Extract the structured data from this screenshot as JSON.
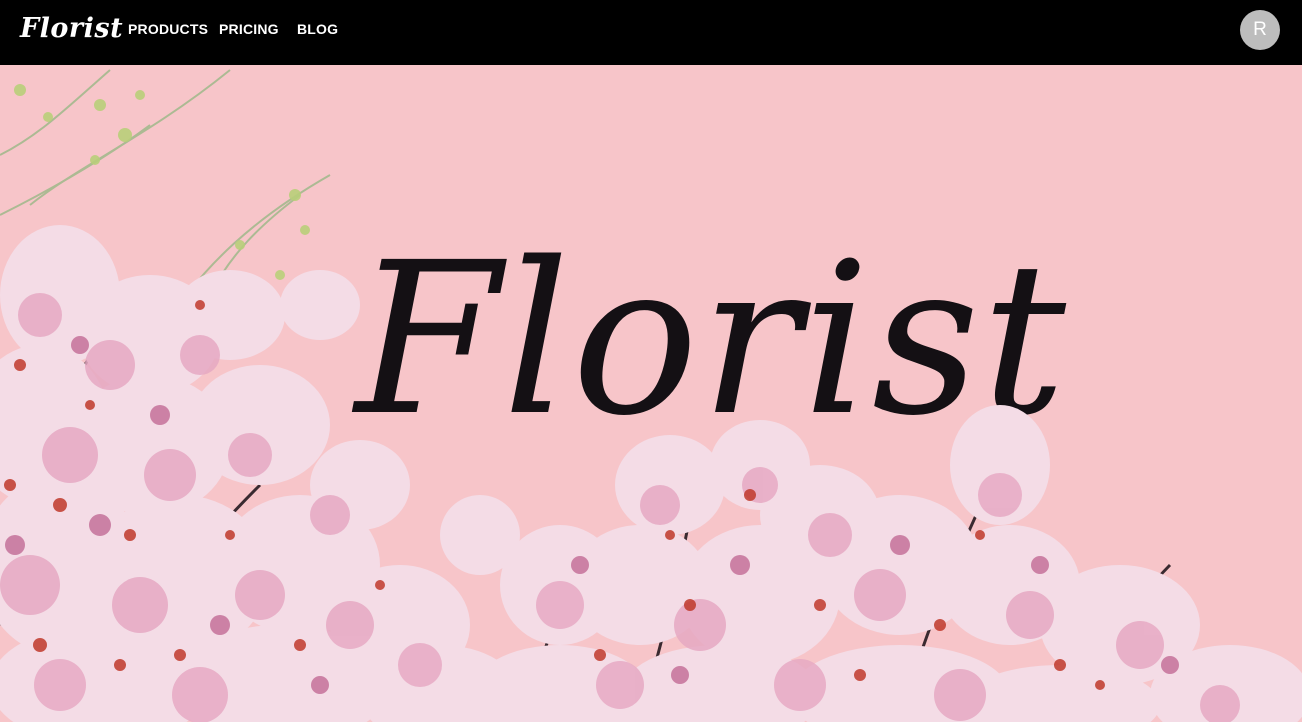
{
  "nav": {
    "brand": "Florist",
    "links": [
      "PRODUCTS",
      "PRICING",
      "BLOG"
    ],
    "avatar_initial": "R"
  },
  "hero": {
    "title": "Florist",
    "background_color": "#f7c5c9",
    "image_description_icon": "cherry-blossom-branches"
  },
  "colors": {
    "nav_bg": "#000000",
    "nav_text": "#ffffff",
    "avatar_bg": "#bdbdbd",
    "hero_bg": "#f7c5c9",
    "title_text": "#141014",
    "blossom_light": "#f4dce6",
    "blossom_mid": "#e6a9c3",
    "blossom_dark": "#b0457a",
    "leaf_red": "#c0392b",
    "branch": "#3a2a30",
    "leaf_green": "#a8c36a"
  }
}
